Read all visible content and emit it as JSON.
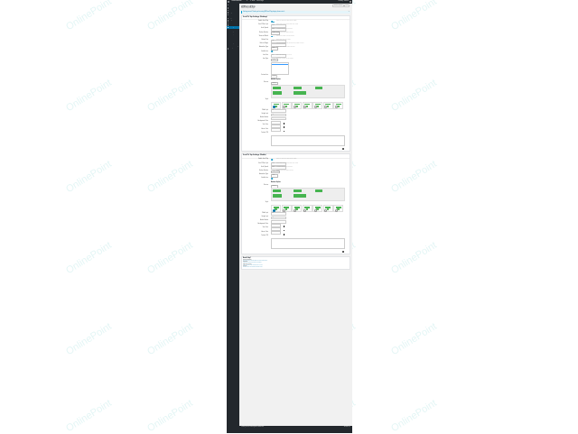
{
  "admin_bar": {
    "site_name": "OnlineWebsite",
    "items": [
      "0",
      "+ New",
      "View Page"
    ],
    "howdy": "Howdy, admin"
  },
  "sidebar": {
    "items": [
      {
        "label": "Dashboard",
        "type": "top"
      },
      {
        "label": "Posts",
        "type": "top"
      },
      {
        "label": "Media",
        "type": "top"
      },
      {
        "label": "Pages",
        "type": "top"
      },
      {
        "label": "Comments",
        "type": "top"
      },
      {
        "label": "Appearance",
        "type": "top"
      },
      {
        "label": "Plugins",
        "type": "top"
      },
      {
        "label": "Users",
        "type": "top"
      },
      {
        "label": "Tools",
        "type": "top"
      },
      {
        "label": "Settings",
        "type": "active"
      },
      {
        "label": "General",
        "type": "sub"
      },
      {
        "label": "Writing",
        "type": "sub"
      },
      {
        "label": "Reading",
        "type": "sub"
      },
      {
        "label": "Discussion",
        "type": "sub"
      },
      {
        "label": "Media",
        "type": "sub"
      },
      {
        "label": "Permalinks",
        "type": "sub"
      },
      {
        "label": "Privacy",
        "type": "sub"
      },
      {
        "label": "WP Scroll Top",
        "type": "sub-current"
      },
      {
        "label": "Collapse menu",
        "type": "top"
      }
    ]
  },
  "header": {
    "title": "WPScrollTop",
    "subtitle": "Scroll To Top Settings",
    "screen_options": "Screen Options",
    "help": "Help"
  },
  "notice": {
    "text": "Settings saved. Thank you for using WP Scroll Top plugin, please rate it.",
    "dismiss": "×"
  },
  "sections": [
    {
      "heading": "Scroll To Top Settings (Desktop)",
      "rows": [
        {
          "label": "Enable Scroll Top",
          "kind": "toggle",
          "on": true,
          "desc": "Enable or disable the scroll to top button"
        },
        {
          "label": "Scroll Offset (px)",
          "kind": "input",
          "value": "100",
          "desc": "Show button after scrolling this many pixels"
        },
        {
          "label": "Scroll Speed",
          "kind": "input",
          "value": "800",
          "desc": "Animation speed in milliseconds"
        },
        {
          "label": "Button Position",
          "kind": "select",
          "value": "Bottom Right",
          "desc": "Choose where the button appears"
        },
        {
          "label": "Show on Mobile",
          "kind": "toggle",
          "on": true,
          "desc": "Display the button on small screens"
        },
        {
          "label": "Button Text",
          "kind": "input",
          "value": "Top",
          "desc": "Text shown inside the button"
        },
        {
          "label": "Hide on Pages",
          "kind": "input",
          "value": "",
          "desc": "Comma separated page IDs where the button is hidden"
        },
        {
          "label": "Animation Type",
          "kind": "select",
          "value": "Fade",
          "desc": "Effect used when the button appears"
        },
        {
          "label": "Enable Icon",
          "kind": "toggle",
          "on": true,
          "desc": ""
        },
        {
          "label": "Icon Size",
          "kind": "input",
          "value": "24",
          "desc": "Size of the arrow icon in pixels"
        },
        {
          "label": "Icon Type",
          "kind": "select",
          "value": "Arrow",
          "desc": "Select an icon style for the button"
        }
      ],
      "icon_list": [
        "Arrow Up",
        "Chevron Up",
        "Caret Up",
        "Angle Double Up",
        "Long Arrow Up",
        "Hand Up",
        "Arrow Circle Up",
        "Chevron Circle Up",
        "Caret Square Up"
      ],
      "icon_list_selected": 1,
      "extra_label": "Custom Icon",
      "extra_button": "Upload",
      "style_heading": "Button Styles",
      "preview_label": "Preview",
      "preview_select": "Square",
      "preview_buttons": [
        "Top",
        "Scroll Top",
        "Up",
        "Back to Top",
        "Go Up"
      ],
      "styles_label": "Style",
      "style_count": 7,
      "style_checked": 0,
      "after_rows": [
        {
          "label": "Width (px)",
          "value": "40"
        },
        {
          "label": "Height (px)",
          "value": "40"
        },
        {
          "label": "Border Radius",
          "value": "4"
        },
        {
          "label": "Background Color",
          "color": "#000000"
        },
        {
          "label": "Text Color",
          "color": "#000000"
        },
        {
          "label": "Hover Color",
          "color": "#000000"
        }
      ],
      "custom_css_label": "Custom CSS"
    },
    {
      "heading": "Scroll To Top Settings (Mobile)",
      "rows": [
        {
          "label": "Enable Scroll Top",
          "kind": "toggle",
          "on": true,
          "desc": "Enable or disable the scroll to top button"
        },
        {
          "label": "Scroll Offset (px)",
          "kind": "input",
          "value": "100",
          "desc": "Show button after scrolling this many pixels"
        },
        {
          "label": "Scroll Speed",
          "kind": "input",
          "value": "800",
          "desc": "Animation speed in milliseconds"
        },
        {
          "label": "Button Position",
          "kind": "select",
          "value": "Bottom Right",
          "desc": "Choose where the button appears"
        },
        {
          "label": "Animation Type",
          "kind": "select",
          "value": "Fade",
          "desc": ""
        },
        {
          "label": "Enable Icon",
          "kind": "toggle",
          "on": true,
          "desc": ""
        }
      ],
      "style_heading": "Button Styles",
      "preview_label": "Preview",
      "preview_select": "Square",
      "preview_buttons": [
        "Top",
        "Scroll Top",
        "Up",
        "Back to Top",
        "Go Up"
      ],
      "styles_label": "Style",
      "style_count": 7,
      "style_checked": 0,
      "after_rows": [
        {
          "label": "Width (px)",
          "value": "40"
        },
        {
          "label": "Height (px)",
          "value": "40"
        },
        {
          "label": "Border Radius",
          "value": "4"
        },
        {
          "label": "Background Color",
          "color": "#000000"
        },
        {
          "label": "Text Color",
          "color": "#000000"
        },
        {
          "label": "Hover Color",
          "color": "#000000"
        }
      ],
      "custom_css_label": "Custom CSS"
    }
  ],
  "help": {
    "title": "Need Help?",
    "items": [
      {
        "q": "Documentation",
        "a": "Read the plugin documentation for setup instructions"
      },
      {
        "q": "Support",
        "a": "Visit the support forum to ask a question"
      },
      {
        "q": "Rate the plugin",
        "a": "If you like this plugin please leave a review"
      },
      {
        "q": "Donate",
        "a": "Support further development of this plugin"
      }
    ]
  },
  "footer": {
    "text": "Thank you for creating with WordPress.",
    "version": "Version 5.2"
  },
  "watermark": "OnlinePoint",
  "colors": {
    "accent": "#0073aa",
    "toggle_on": "#2ea2cc",
    "preview_green": "#46b450",
    "admin_dark": "#23282d"
  }
}
